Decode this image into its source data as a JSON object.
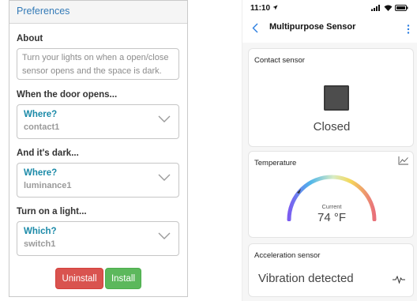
{
  "preferences": {
    "header": "Preferences",
    "about": {
      "label": "About",
      "text": "Turn your lights on when a open/close sensor opens and the space is dark."
    },
    "door": {
      "label": "When the door opens...",
      "select_title": "Where?",
      "select_value": "contact1"
    },
    "dark": {
      "label": "And it's dark...",
      "select_title": "Where?",
      "select_value": "luminance1"
    },
    "light": {
      "label": "Turn on a light...",
      "select_title": "Which?",
      "select_value": "switch1"
    },
    "buttons": {
      "uninstall": "Uninstall",
      "install": "Install"
    }
  },
  "phone": {
    "status_bar": {
      "time": "11:10"
    },
    "header": {
      "title": "Multipurpose Sensor"
    },
    "contact": {
      "label": "Contact sensor",
      "state": "Closed"
    },
    "temperature": {
      "label": "Temperature",
      "current_label": "Current",
      "value": "74 °F"
    },
    "acceleration": {
      "label": "Acceleration sensor",
      "state": "Vibration detected"
    }
  },
  "colors": {
    "link_blue": "#337ab7",
    "select_teal": "#1b8aa8",
    "uninstall_red": "#d9534f",
    "install_green": "#5cb85c",
    "ios_blue": "#2a7de1"
  },
  "icons": [
    "chevron-down-icon",
    "location-arrow-icon",
    "signal-icon",
    "wifi-icon",
    "battery-icon",
    "back-arrow-icon",
    "more-vertical-icon",
    "door-icon",
    "line-chart-icon",
    "pulse-icon"
  ]
}
